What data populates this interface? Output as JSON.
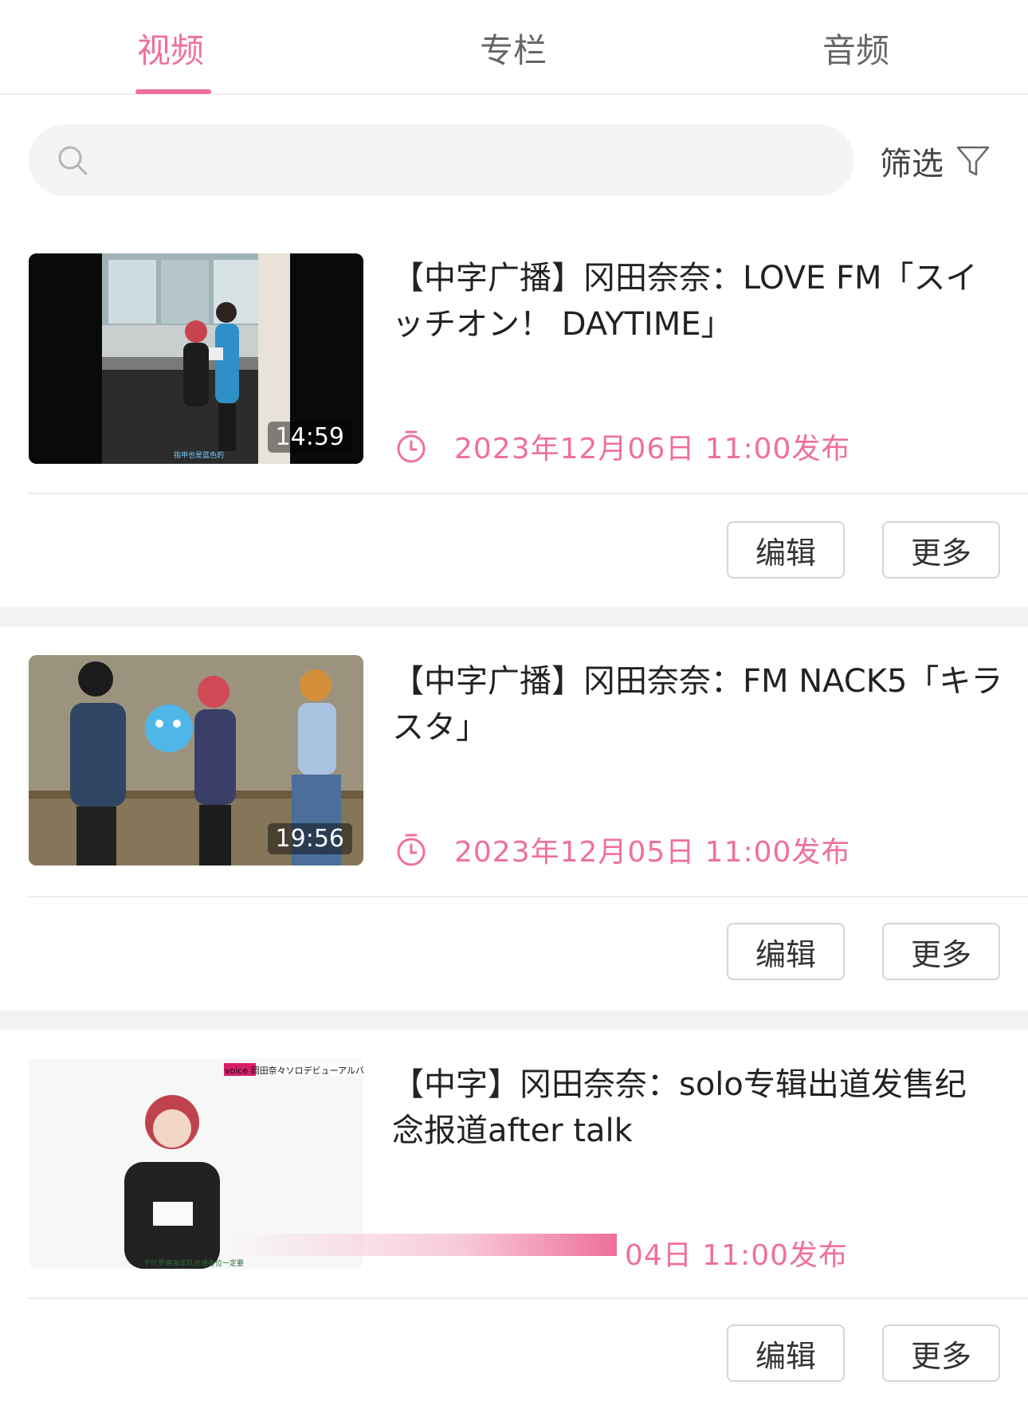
{
  "tabs": [
    {
      "label": "视频",
      "active": true
    },
    {
      "label": "专栏",
      "active": false
    },
    {
      "label": "音频",
      "active": false
    }
  ],
  "search": {
    "placeholder": "",
    "value": ""
  },
  "filter": {
    "label": "筛选"
  },
  "accent_color": "#f0709b",
  "videos": [
    {
      "title": "【中字广播】冈田奈奈：LOVE FM「スイッチオン！ DAYTIME」",
      "duration": "14:59",
      "publish": "2023年12月06日 11:00发布",
      "thumb_caption": "指甲也是蓝色的",
      "edit_label": "编辑",
      "more_label": "更多"
    },
    {
      "title": "【中字广播】冈田奈奈：FM NACK5「キラスタ」",
      "duration": "19:56",
      "publish": "2023年12月05日 11:00发布",
      "edit_label": "编辑",
      "more_label": "更多"
    },
    {
      "title": "【中字】冈田奈奈：solo专辑出道发售纪念报道after talk",
      "duration": "",
      "publish": "04日 11:00发布",
      "thumb_banner": "voice 岡田奈々ソロデビューアルバ",
      "thumb_caption": "千叶罗德海洋队也请各位一定要",
      "edit_label": "编辑",
      "more_label": "更多"
    }
  ]
}
